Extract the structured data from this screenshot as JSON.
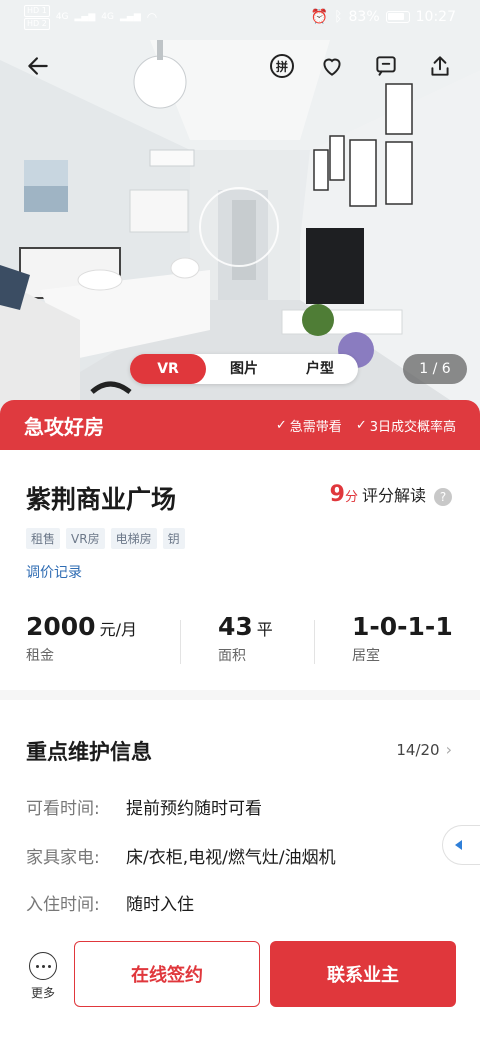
{
  "status_bar": {
    "sim1": "HD 1",
    "sim2": "HD 2",
    "network1": "4G",
    "network2": "4G",
    "battery": "83%",
    "time": "10:27"
  },
  "header_actions": {
    "back_icon": "arrow-left-icon",
    "pinyin_icon": "pinyin-icon",
    "pinyin_text": "拼",
    "favorite_icon": "heart-icon",
    "message_icon": "chat-icon",
    "share_icon": "share-icon"
  },
  "media": {
    "tabs": [
      {
        "label": "VR",
        "active": true
      },
      {
        "label": "图片",
        "active": false
      },
      {
        "label": "户型",
        "active": false
      }
    ],
    "counter": "1 / 6"
  },
  "urgent_banner": {
    "title": "急攻好房",
    "tags": [
      "急需带看",
      "3日成交概率高"
    ]
  },
  "listing": {
    "title": "紫荆商业广场",
    "score_value": "9",
    "score_unit": "分",
    "score_label": "评分解读",
    "tags": [
      "租售",
      "VR房",
      "电梯房",
      "钥"
    ],
    "price_history_link": "调价记录",
    "facts": [
      {
        "value": "2000",
        "unit": "元/月",
        "label": "租金"
      },
      {
        "value": "43",
        "unit": "平",
        "label": "面积"
      },
      {
        "value": "1-0-1-1",
        "unit": "",
        "label": "居室"
      }
    ]
  },
  "maintenance": {
    "title": "重点维护信息",
    "pager": "14/20",
    "items": [
      {
        "key": "可看时间:",
        "value": "提前预约随时可看"
      },
      {
        "key": "家具家电:",
        "value": "床/衣柜,电视/燃气灶/油烟机"
      },
      {
        "key": "入住时间:",
        "value": "随时入住"
      }
    ]
  },
  "bottom_bar": {
    "more_label": "更多",
    "sign_online": "在线签约",
    "contact_owner": "联系业主"
  },
  "colors": {
    "accent": "#e0373c",
    "link": "#2f6cb3",
    "tag_bg": "#eef2f6"
  }
}
